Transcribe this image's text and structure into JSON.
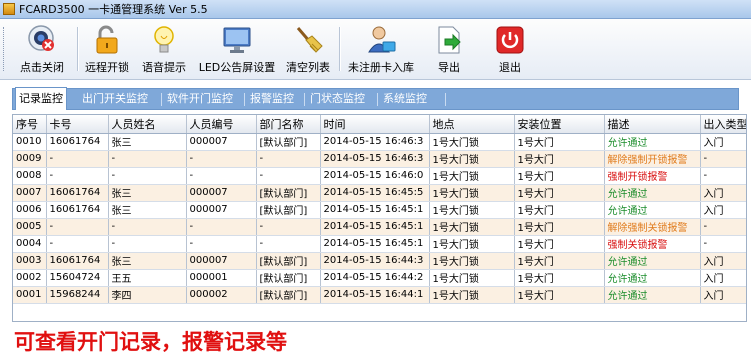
{
  "window": {
    "title": "FCARD3500 一卡通管理系统  Ver 5.5"
  },
  "toolbar": {
    "buttons": [
      {
        "label": "点击关闭",
        "icon": "webcam-icon"
      },
      {
        "label": "远程开锁",
        "icon": "unlock-icon"
      },
      {
        "label": "语音提示",
        "icon": "lightbulb-icon"
      },
      {
        "label": "LED公告屏设置",
        "icon": "monitor-icon"
      },
      {
        "label": "清空列表",
        "icon": "broom-icon"
      },
      {
        "label": "未注册卡入库",
        "icon": "user-card-icon"
      },
      {
        "label": "导出",
        "icon": "export-icon"
      },
      {
        "label": "退出",
        "icon": "power-icon"
      }
    ]
  },
  "tabs": [
    "记录监控",
    "出门开关监控",
    "软件开门监控",
    "报警监控",
    "门状态监控",
    "系统监控"
  ],
  "table": {
    "columns": [
      "序号",
      "卡号",
      "人员姓名",
      "人员编号",
      "部门名称",
      "时间",
      "地点",
      "安装位置",
      "描述",
      "出入类型"
    ],
    "rows": [
      {
        "cells": [
          "0010",
          "16061764",
          "张三",
          "000007",
          "[默认部门]",
          "2014-05-15 16:46:3",
          "1号大门锁",
          "1号大门",
          "允许通过",
          "入门"
        ],
        "desc_color": "green"
      },
      {
        "cells": [
          "0009",
          "-",
          "-",
          "-",
          "-",
          "2014-05-15 16:46:3",
          "1号大门锁",
          "1号大门",
          "解除强制开锁报警",
          "-"
        ],
        "desc_color": "orange"
      },
      {
        "cells": [
          "0008",
          "-",
          "-",
          "-",
          "-",
          "2014-05-15 16:46:0",
          "1号大门锁",
          "1号大门",
          "强制开锁报警",
          "-"
        ],
        "desc_color": "red"
      },
      {
        "cells": [
          "0007",
          "16061764",
          "张三",
          "000007",
          "[默认部门]",
          "2014-05-15 16:45:5",
          "1号大门锁",
          "1号大门",
          "允许通过",
          "入门"
        ],
        "desc_color": "green"
      },
      {
        "cells": [
          "0006",
          "16061764",
          "张三",
          "000007",
          "[默认部门]",
          "2014-05-15 16:45:1",
          "1号大门锁",
          "1号大门",
          "允许通过",
          "入门"
        ],
        "desc_color": "green"
      },
      {
        "cells": [
          "0005",
          "-",
          "-",
          "-",
          "-",
          "2014-05-15 16:45:1",
          "1号大门锁",
          "1号大门",
          "解除强制关锁报警",
          "-"
        ],
        "desc_color": "orange"
      },
      {
        "cells": [
          "0004",
          "-",
          "-",
          "-",
          "-",
          "2014-05-15 16:45:1",
          "1号大门锁",
          "1号大门",
          "强制关锁报警",
          "-"
        ],
        "desc_color": "red"
      },
      {
        "cells": [
          "0003",
          "16061764",
          "张三",
          "000007",
          "[默认部门]",
          "2014-05-15 16:44:3",
          "1号大门锁",
          "1号大门",
          "允许通过",
          "入门"
        ],
        "desc_color": "green"
      },
      {
        "cells": [
          "0002",
          "15604724",
          "王五",
          "000001",
          "[默认部门]",
          "2014-05-15 16:44:2",
          "1号大门锁",
          "1号大门",
          "允许通过",
          "入门"
        ],
        "desc_color": "green"
      },
      {
        "cells": [
          "0001",
          "15968244",
          "李四",
          "000002",
          "[默认部门]",
          "2014-05-15 16:44:1",
          "1号大门锁",
          "1号大门",
          "允许通过",
          "入门"
        ],
        "desc_color": "green"
      }
    ]
  },
  "note": "可查看开门记录，报警记录等",
  "colors": {
    "allow": "#1a8c2a",
    "release": "#e07b1c",
    "alarm": "#d81010",
    "note": "#e01010"
  }
}
